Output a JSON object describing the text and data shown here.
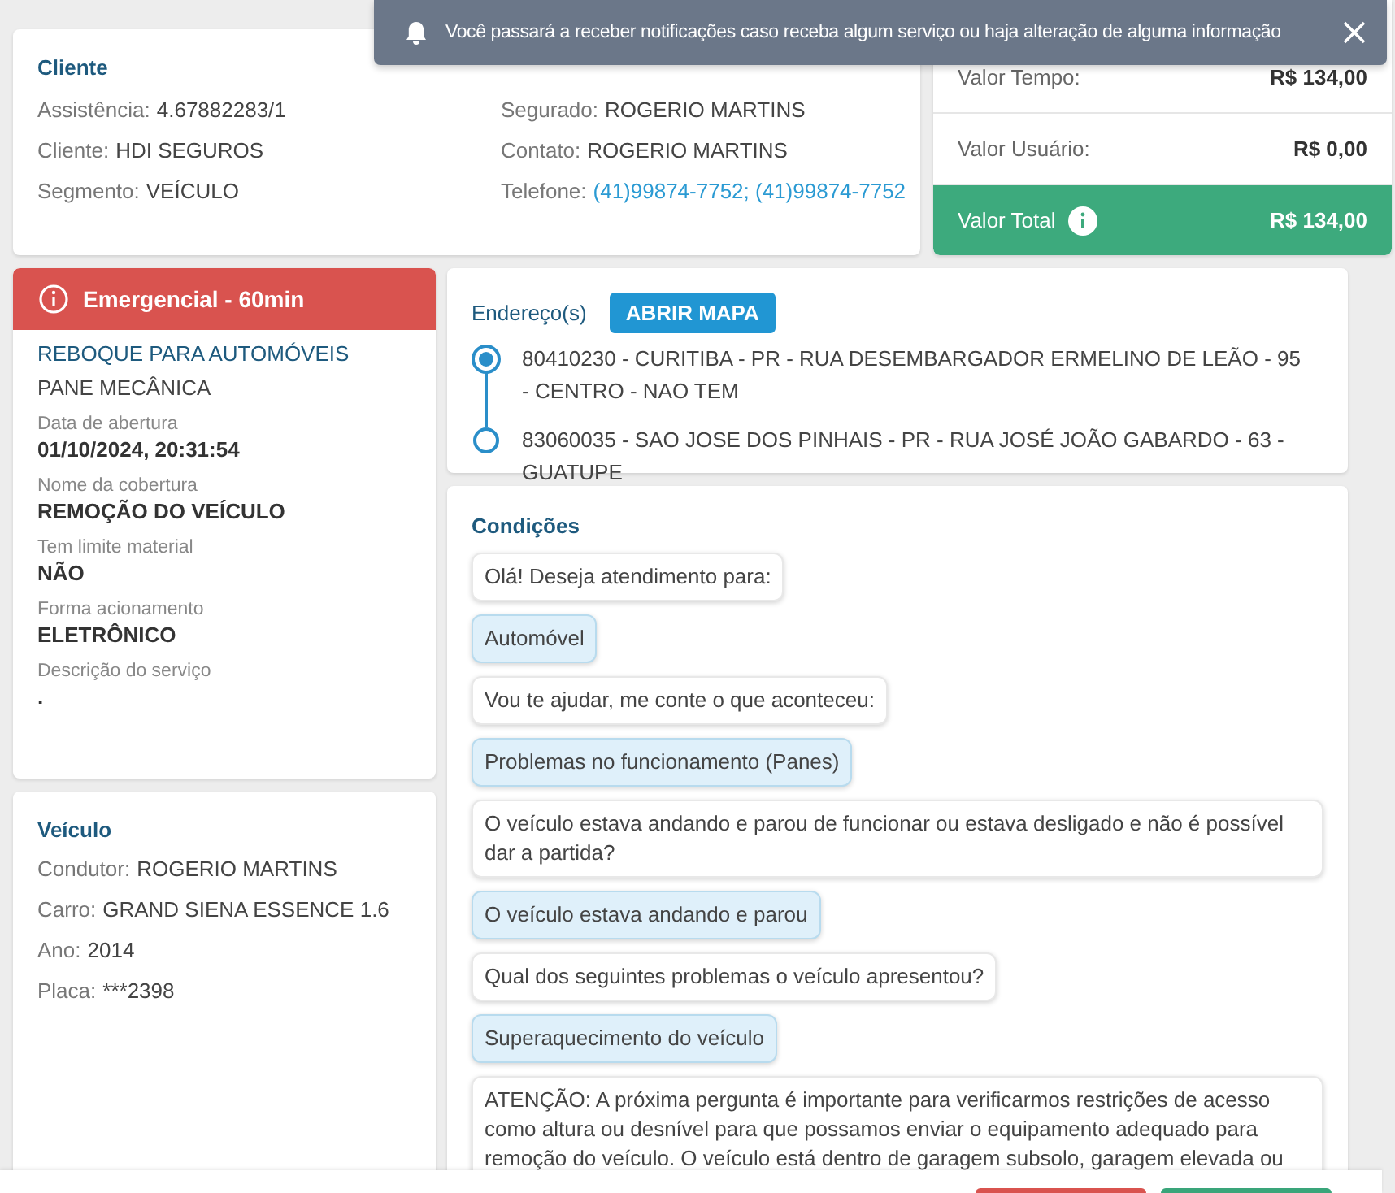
{
  "notification": {
    "text": "Você passará a receber notificações caso receba algum serviço ou haja alteração de alguma informação"
  },
  "client": {
    "title": "Cliente",
    "fields": [
      {
        "label": "Assistência:",
        "value": "4.67882283/1",
        "kind": "text"
      },
      {
        "label": "Cliente:",
        "value": "HDI SEGUROS",
        "kind": "text"
      },
      {
        "label": "Segmento:",
        "value": "VEÍCULO",
        "kind": "text"
      },
      {
        "label": "Segurado:",
        "value": "ROGERIO MARTINS",
        "kind": "text"
      },
      {
        "label": "Contato:",
        "value": "ROGERIO MARTINS",
        "kind": "text"
      },
      {
        "label": "Telefone:",
        "value": "(41)99874-7752; (41)99874-7752",
        "kind": "link"
      }
    ]
  },
  "values": [
    {
      "label": "Valor Tempo:",
      "value": "R$ 134,00",
      "kind": "plain"
    },
    {
      "label": "Valor Usuário:",
      "value": "R$ 0,00",
      "kind": "plain"
    },
    {
      "label": "Valor Total",
      "value": "R$ 134,00",
      "kind": "total"
    }
  ],
  "service": {
    "priority": "Emergencial - 60min",
    "title": "REBOQUE PARA AUTOMÓVEIS",
    "subtitle": "PANE MECÂNICA",
    "details": [
      {
        "label": "Data de abertura",
        "value": "01/10/2024, 20:31:54"
      },
      {
        "label": "Nome da cobertura",
        "value": "REMOÇÃO DO VEÍCULO"
      },
      {
        "label": "Tem limite material",
        "value": "NÃO"
      },
      {
        "label": "Forma acionamento",
        "value": "ELETRÔNICO"
      },
      {
        "label": "Descrição do serviço",
        "value": "."
      }
    ]
  },
  "vehicle": {
    "title": "Veículo",
    "fields": [
      {
        "label": "Condutor:",
        "value": "ROGERIO MARTINS"
      },
      {
        "label": "Carro:",
        "value": "GRAND SIENA ESSENCE 1.6"
      },
      {
        "label": "Ano:",
        "value": "2014"
      },
      {
        "label": "Placa:",
        "value": "***2398"
      }
    ]
  },
  "addresses": {
    "title": "Endereço(s)",
    "button": "ABRIR MAPA",
    "stops": [
      {
        "kind": "origin",
        "text": "80410230 - CURITIBA - PR - RUA DESEMBARGADOR ERMELINO DE LEÃO - 95 - CENTRO - NAO TEM"
      },
      {
        "kind": "destination",
        "text": "83060035 - SAO JOSE DOS PINHAIS - PR - RUA JOSÉ JOÃO GABARDO - 63 - GUATUPE"
      }
    ]
  },
  "conditions": {
    "title": "Condições",
    "messages": [
      {
        "kind": "question",
        "text": "Olá! Deseja atendimento para:"
      },
      {
        "kind": "answer",
        "text": "Automóvel"
      },
      {
        "kind": "question",
        "text": "Vou te ajudar, me conte o que aconteceu:"
      },
      {
        "kind": "answer",
        "text": "Problemas no funcionamento (Panes)"
      },
      {
        "kind": "question",
        "text": "O veículo estava andando e parou de funcionar ou estava desligado e não é possível dar a partida?"
      },
      {
        "kind": "answer",
        "text": "O veículo estava andando e parou"
      },
      {
        "kind": "question",
        "text": "Qual dos seguintes problemas o veículo apresentou?"
      },
      {
        "kind": "answer",
        "text": "Superaquecimento do veículo"
      },
      {
        "kind": "question",
        "text": "ATENÇÃO: A próxima pergunta é importante para verificarmos restrições de acesso como altura ou desnível para que possamos enviar o equipamento adequado para remoção do veículo. O veículo está dentro de garagem subsolo, garagem elevada ou"
      }
    ]
  },
  "footer_buttons": [
    {
      "color": "#d9534f"
    },
    {
      "color": "#3aa57a"
    }
  ]
}
